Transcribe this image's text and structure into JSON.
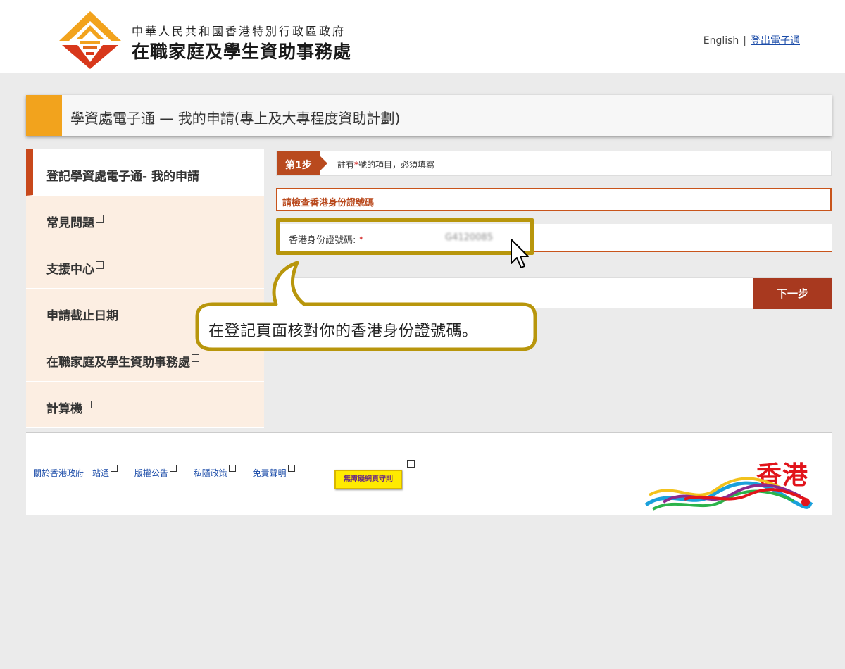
{
  "header": {
    "org_line1": "中華人民共和國香港特別行政區政府",
    "org_line2": "在職家庭及學生資助事務處",
    "lang_link": "English",
    "separator": "|",
    "logout_link": "登出電子通"
  },
  "title_bar": {
    "title": "學資處電子通 — 我的申請(專上及大專程度資助計劃)"
  },
  "sidebar": {
    "items": [
      {
        "label": "登記學資處電子通- 我的申請",
        "external": false,
        "active": true
      },
      {
        "label": "常見問題",
        "external": true,
        "active": false
      },
      {
        "label": "支援中心",
        "external": true,
        "active": false
      },
      {
        "label": "申請截止日期",
        "external": true,
        "active": false
      },
      {
        "label": "在職家庭及學生資助事務處",
        "external": true,
        "active": false
      },
      {
        "label": "計算機",
        "external": true,
        "active": false
      }
    ]
  },
  "step": {
    "badge": "第1步",
    "note_prefix": "註有",
    "note_star": "*",
    "note_suffix": "號的項目，必須填寫"
  },
  "form": {
    "section_title": "請檢查香港身份證號碼",
    "id_label": "香港身份證號碼:",
    "required_mark": "*",
    "id_value": "G4120085",
    "next_button": "下一步"
  },
  "callout": {
    "text": "在登記頁面核對你的香港身份證號碼。"
  },
  "footer": {
    "links": [
      "關於香港政府一站通",
      "版權公告",
      "私隱政策",
      "免責聲明"
    ],
    "accessibility_badge": "無障礙網頁守則",
    "brand": "香港"
  },
  "colors": {
    "accent_orange": "#f2a31d",
    "accent_rust": "#c8481b",
    "button_red": "#a8391f",
    "callout_gold": "#b8960c"
  }
}
